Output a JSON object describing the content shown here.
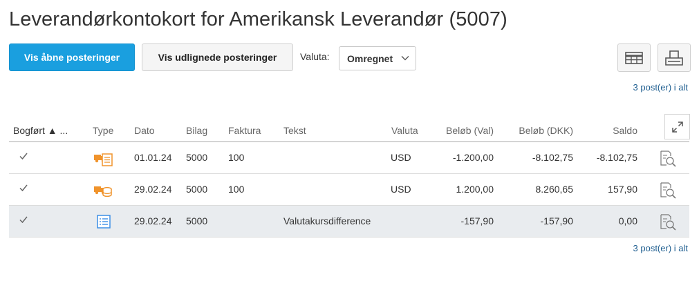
{
  "title": "Leverandørkontokort for Amerikansk Leverandør (5007)",
  "toolbar": {
    "open_items_label": "Vis åbne posteringer",
    "cleared_items_label": "Vis udlignede posteringer",
    "currency_label": "Valuta:",
    "currency_value": "Omregnet",
    "grid_icon": "table-settings-icon",
    "print_icon": "print-icon"
  },
  "count_text": "3 post(er) i alt",
  "colors": {
    "primary": "#1a9fdf",
    "link": "#1d5d8f",
    "type_icon": "#f0932b",
    "doc_icon": "#3a8ee6"
  },
  "table": {
    "headers": {
      "posted": "Bogført",
      "sort_indicator": "▲ ...",
      "type": "Type",
      "date": "Dato",
      "voucher": "Bilag",
      "invoice": "Faktura",
      "text": "Tekst",
      "currency": "Valuta",
      "amount_cur": "Beløb (Val)",
      "amount_dkk": "Beløb (DKK)",
      "balance": "Saldo"
    },
    "rows": [
      {
        "type_icon": "invoice-truck-icon",
        "date": "01.01.24",
        "voucher": "5000",
        "invoice": "100",
        "text": "",
        "currency": "USD",
        "amount_cur": "-1.200,00",
        "amount_dkk": "-8.102,75",
        "balance": "-8.102,75"
      },
      {
        "type_icon": "payment-truck-icon",
        "date": "29.02.24",
        "voucher": "5000",
        "invoice": "100",
        "text": "",
        "currency": "USD",
        "amount_cur": "1.200,00",
        "amount_dkk": "8.260,65",
        "balance": "157,90"
      },
      {
        "type_icon": "journal-document-icon",
        "date": "29.02.24",
        "voucher": "5000",
        "invoice": "",
        "text": "Valutakursdifference",
        "currency": "",
        "amount_cur": "-157,90",
        "amount_dkk": "-157,90",
        "balance": "0,00"
      }
    ]
  }
}
